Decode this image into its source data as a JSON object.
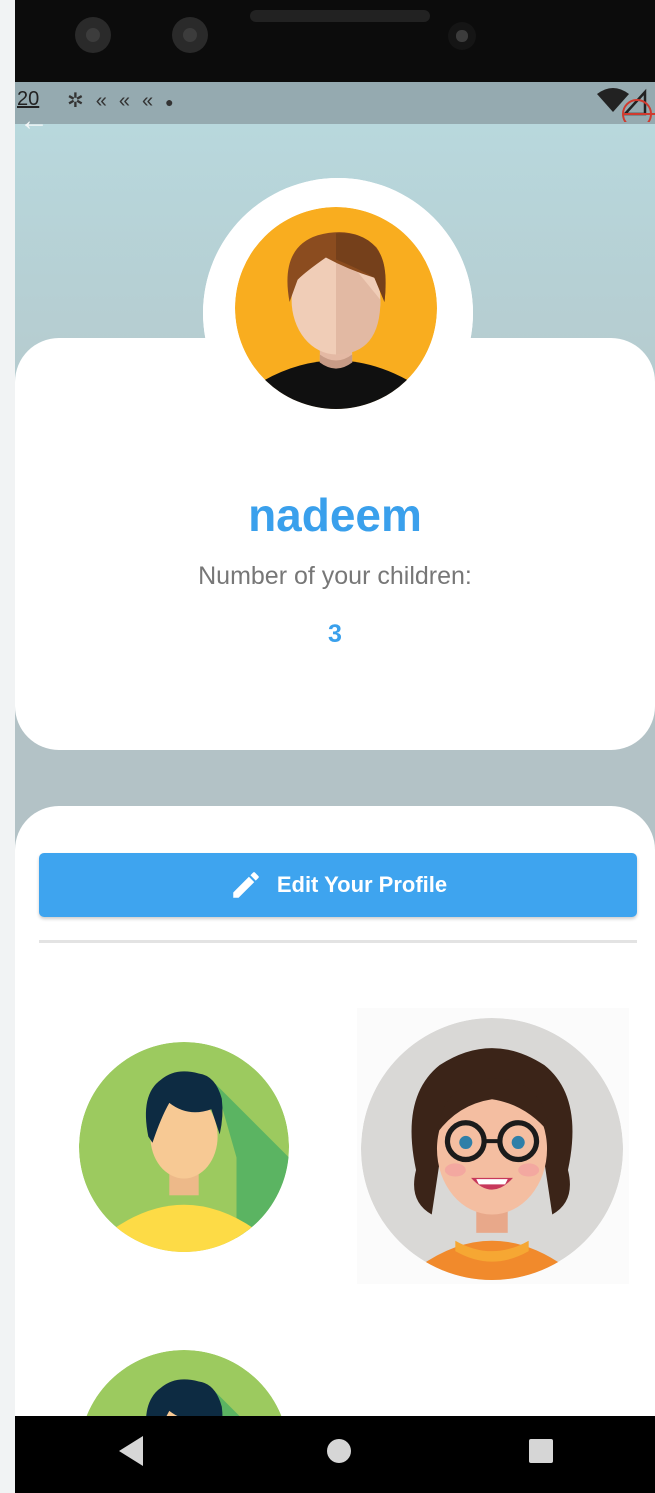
{
  "status_bar": {
    "time": "20",
    "icons": [
      "gear-icon",
      "flutter-icon",
      "flutter-icon",
      "flutter-icon",
      "dot-icon"
    ],
    "right_icons": [
      "wifi-icon",
      "signal-icon"
    ]
  },
  "profile": {
    "name": "nadeem",
    "children_label": "Number of your children:",
    "children_count": "3"
  },
  "actions": {
    "edit_label": "Edit Your Profile"
  },
  "children_avatars": [
    "boy-avatar",
    "girl-with-glasses-avatar",
    "boy-avatar"
  ],
  "nav": [
    "back-nav-icon",
    "home-nav-icon",
    "recents-nav-icon"
  ],
  "colors": {
    "accent": "#3ea4ef",
    "name_text": "#3aa0ec",
    "header_bg": "#b8d8dd"
  }
}
